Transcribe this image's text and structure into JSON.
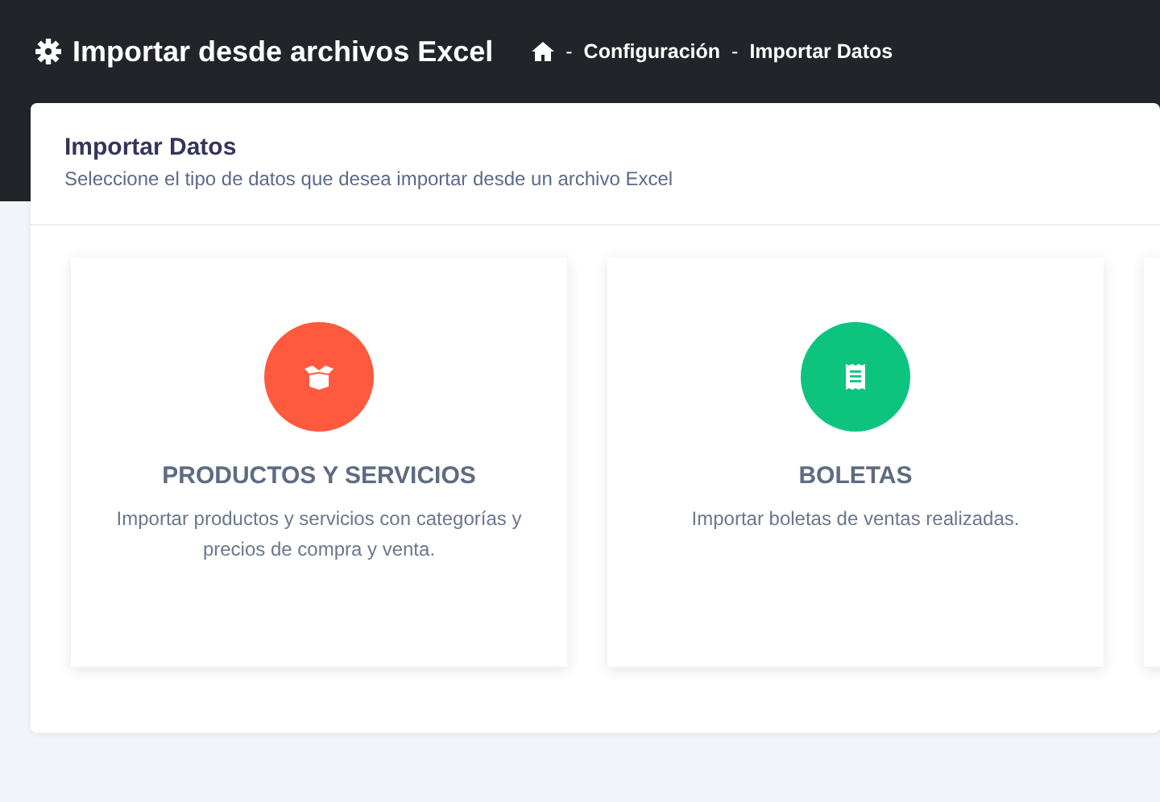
{
  "header": {
    "title": "Importar desde archivos Excel",
    "breadcrumb": [
      {
        "kind": "home"
      },
      {
        "kind": "link",
        "separator": "-",
        "label": "Configuración"
      },
      {
        "kind": "current",
        "separator": "-",
        "label": "Importar Datos"
      }
    ]
  },
  "panel": {
    "title": "Importar Datos",
    "subtitle": "Seleccione el tipo de datos que desea importar desde un archivo Excel"
  },
  "options": [
    {
      "kind": "box",
      "color": "#ff5a3d",
      "title": "PRODUCTOS Y SERVICIOS",
      "description": "Importar productos y servicios con categorías y precios de compra y venta."
    },
    {
      "kind": "receipt",
      "color": "#0dc47f",
      "title": "BOLETAS",
      "description": "Importar boletas de ventas realizadas."
    }
  ]
}
